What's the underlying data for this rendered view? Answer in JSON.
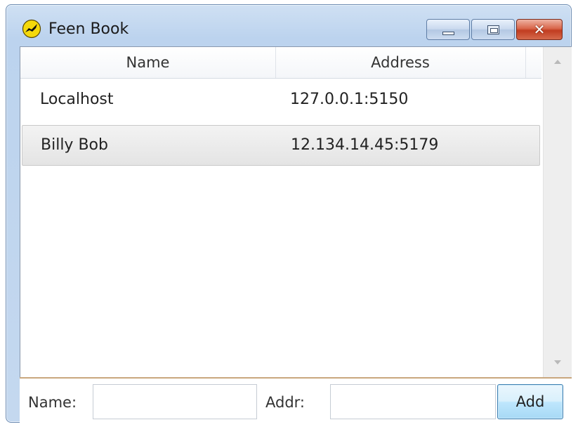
{
  "window": {
    "title": "Feen Book",
    "icon": "app-logo-icon",
    "controls": {
      "minimize": "minimize-icon",
      "maximize": "maximize-icon",
      "close_glyph": "✕"
    }
  },
  "table": {
    "columns": {
      "name": "Name",
      "address": "Address"
    },
    "rows": [
      {
        "name": "Localhost",
        "address": "127.0.0.1:5150",
        "selected": false
      },
      {
        "name": "Billy Bob",
        "address": "12.134.14.45:5179",
        "selected": true
      }
    ]
  },
  "form": {
    "name_label": "Name:",
    "name_value": "",
    "addr_label": "Addr:",
    "addr_value": "",
    "add_button": "Add"
  },
  "colors": {
    "title_bar": "#c4d8ef",
    "close_button": "#c13c20",
    "selected_row": "#e4e4e4",
    "add_button": "#bee6fd"
  }
}
